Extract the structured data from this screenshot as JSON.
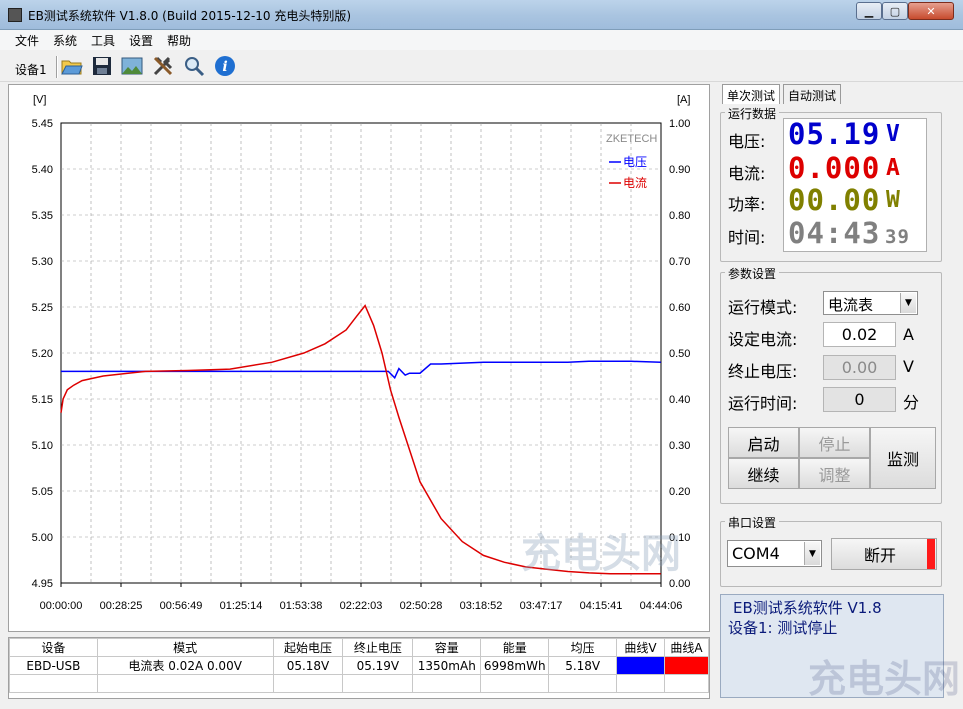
{
  "window": {
    "title": "EB测试系统软件 V1.8.0 (Build 2015-12-10 充电头特别版)",
    "min": "▁",
    "max": "▢",
    "close": "✕"
  },
  "menu": [
    "文件",
    "系统",
    "工具",
    "设置",
    "帮助"
  ],
  "toolbar": {
    "device": "设备1",
    "icons": [
      "open-folder-icon",
      "save-icon",
      "image-icon",
      "tools-icon",
      "search-icon",
      "info-icon"
    ]
  },
  "chart_data": {
    "type": "line",
    "title": "",
    "brand": "ZKETECH",
    "left_unit": "[V]",
    "right_unit": "[A]",
    "x_ticks": [
      "00:00:00",
      "00:28:25",
      "00:56:49",
      "01:25:14",
      "01:53:38",
      "02:22:03",
      "02:50:28",
      "03:18:52",
      "03:47:17",
      "04:15:41",
      "04:44:06"
    ],
    "y_left": {
      "min": 4.95,
      "max": 5.45,
      "ticks": [
        "5.45",
        "5.40",
        "5.35",
        "5.30",
        "5.25",
        "5.20",
        "5.15",
        "5.10",
        "5.05",
        "5.00",
        "4.95"
      ]
    },
    "y_right": {
      "min": 0,
      "max": 1,
      "ticks": [
        "1.00",
        "0.90",
        "0.80",
        "0.70",
        "0.60",
        "0.50",
        "0.40",
        "0.30",
        "0.20",
        "0.10",
        "0.00"
      ]
    },
    "grid": true,
    "legend_position": "top-right",
    "series": [
      {
        "name": "电压",
        "axis": "left",
        "color": "#0000ff",
        "x_min": [
          0,
          90,
          155,
          158,
          160,
          163,
          165,
          170,
          175,
          180,
          190,
          200,
          210,
          220,
          230,
          240,
          250,
          260,
          270,
          284
        ],
        "values": [
          5.18,
          5.18,
          5.18,
          5.173,
          5.183,
          5.176,
          5.178,
          5.178,
          5.188,
          5.188,
          5.189,
          5.19,
          5.19,
          5.19,
          5.19,
          5.19,
          5.191,
          5.191,
          5.191,
          5.19
        ]
      },
      {
        "name": "电流",
        "axis": "right",
        "color": "#dd0000",
        "x_min": [
          0,
          1,
          3,
          6,
          10,
          20,
          40,
          60,
          80,
          100,
          115,
          125,
          135,
          140,
          144,
          148,
          152,
          156,
          160,
          170,
          180,
          190,
          200,
          210,
          220,
          230,
          240,
          250,
          260,
          270,
          284
        ],
        "values": [
          0.37,
          0.4,
          0.42,
          0.43,
          0.44,
          0.45,
          0.46,
          0.462,
          0.465,
          0.48,
          0.5,
          0.52,
          0.55,
          0.58,
          0.603,
          0.56,
          0.5,
          0.42,
          0.36,
          0.22,
          0.14,
          0.09,
          0.06,
          0.045,
          0.035,
          0.03,
          0.025,
          0.022,
          0.02,
          0.02,
          0.02
        ]
      }
    ],
    "x_range_min": [
      0,
      284.1
    ]
  },
  "table": {
    "headers": [
      "设备",
      "模式",
      "起始电压",
      "终止电压",
      "容量",
      "能量",
      "均压",
      "曲线V",
      "曲线A"
    ],
    "row": [
      "EBD-USB",
      "电流表 0.02A 0.00V",
      "05.18V",
      "05.19V",
      "1350mAh",
      "6998mWh",
      "5.18V",
      "",
      ""
    ],
    "colors": {
      "curveV": "#0000ff",
      "curveA": "#ff0000"
    }
  },
  "tabs": [
    "单次测试",
    "自动测试"
  ],
  "runtime": {
    "title": "运行数据",
    "voltage_label": "电压:",
    "voltage": "05.19",
    "voltage_unit": "V",
    "current_label": "电流:",
    "current": "0.000",
    "current_unit": "A",
    "power_label": "功率:",
    "power": "00.00",
    "power_unit": "W",
    "time_label": "时间:",
    "time": "04:43",
    "seconds": "39"
  },
  "params": {
    "title": "参数设置",
    "mode_label": "运行模式:",
    "mode": "电流表",
    "set_current_label": "设定电流:",
    "set_current": "0.02",
    "set_current_unit": "A",
    "cutoff_label": "终止电压:",
    "cutoff": "0.00",
    "cutoff_unit": "V",
    "runtime_label": "运行时间:",
    "runtime": "0",
    "runtime_unit": "分",
    "start": "启动",
    "stop": "停止",
    "resume": "继续",
    "adjust": "调整",
    "monitor": "监测"
  },
  "serial": {
    "title": "串口设置",
    "port": "COM4",
    "disconnect": "断开"
  },
  "status": {
    "line1": "EB测试系统软件 V1.8",
    "line2": "设备1: 测试停止"
  },
  "colors": {
    "voltage": "#0000cc",
    "current": "#dd0000",
    "power": "#808000",
    "time": "#808080"
  }
}
